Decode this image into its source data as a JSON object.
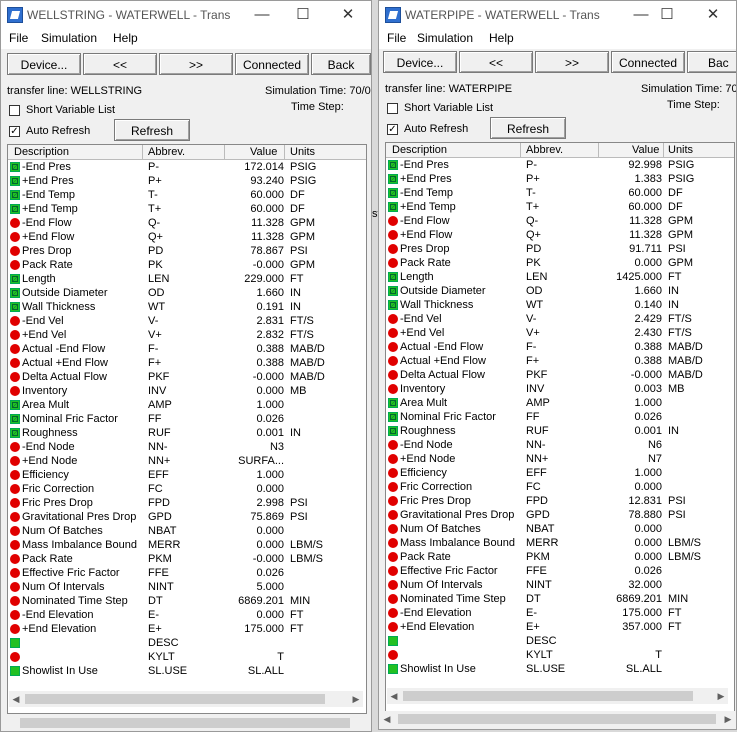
{
  "windows": [
    {
      "title": "WELLSTRING - WATERWELL - Trans",
      "menu": [
        "File",
        "Simulation",
        "Help"
      ],
      "toolbar": {
        "device": "Device...",
        "prev": "<<",
        "next": ">>",
        "connected": "Connected",
        "back": "Back"
      },
      "transfer_line": "transfer line: WELLSTRING",
      "sim_time": "Simulation Time: 70/0",
      "time_step": "Time Step:",
      "short_var": "Short Variable List",
      "auto_refresh": "Auto Refresh",
      "refresh": "Refresh",
      "columns": [
        "Description",
        "Abbrev.",
        "Value",
        "Units"
      ],
      "rows": [
        {
          "i": "g",
          "d": "-End Pres",
          "a": "P-",
          "v": "172.014",
          "u": "PSIG"
        },
        {
          "i": "g",
          "d": "+End Pres",
          "a": "P+",
          "v": "93.240",
          "u": "PSIG"
        },
        {
          "i": "g",
          "d": "-End Temp",
          "a": "T-",
          "v": "60.000",
          "u": "DF"
        },
        {
          "i": "g",
          "d": "+End Temp",
          "a": "T+",
          "v": "60.000",
          "u": "DF"
        },
        {
          "i": "r",
          "d": "-End Flow",
          "a": "Q-",
          "v": "11.328",
          "u": "GPM"
        },
        {
          "i": "r",
          "d": "+End Flow",
          "a": "Q+",
          "v": "11.328",
          "u": "GPM"
        },
        {
          "i": "r",
          "d": "Pres Drop",
          "a": "PD",
          "v": "78.867",
          "u": "PSI"
        },
        {
          "i": "r",
          "d": "Pack Rate",
          "a": "PK",
          "v": "-0.000",
          "u": "GPM"
        },
        {
          "i": "g",
          "d": "Length",
          "a": "LEN",
          "v": "229.000",
          "u": "FT"
        },
        {
          "i": "g",
          "d": "Outside Diameter",
          "a": "OD",
          "v": "1.660",
          "u": "IN"
        },
        {
          "i": "g",
          "d": "Wall Thickness",
          "a": "WT",
          "v": "0.191",
          "u": "IN"
        },
        {
          "i": "r",
          "d": "-End Vel",
          "a": "V-",
          "v": "2.831",
          "u": "FT/S"
        },
        {
          "i": "r",
          "d": "+End Vel",
          "a": "V+",
          "v": "2.832",
          "u": "FT/S"
        },
        {
          "i": "r",
          "d": "Actual -End Flow",
          "a": "F-",
          "v": "0.388",
          "u": "MAB/D"
        },
        {
          "i": "r",
          "d": "Actual +End Flow",
          "a": "F+",
          "v": "0.388",
          "u": "MAB/D"
        },
        {
          "i": "r",
          "d": "Delta Actual Flow",
          "a": "PKF",
          "v": "-0.000",
          "u": "MAB/D"
        },
        {
          "i": "r",
          "d": "Inventory",
          "a": "INV",
          "v": "0.000",
          "u": "MB"
        },
        {
          "i": "g",
          "d": "Area Mult",
          "a": "AMP",
          "v": "1.000",
          "u": ""
        },
        {
          "i": "g",
          "d": "Nominal Fric Factor",
          "a": "FF",
          "v": "0.026",
          "u": ""
        },
        {
          "i": "g",
          "d": "Roughness",
          "a": "RUF",
          "v": "0.001",
          "u": "IN"
        },
        {
          "i": "r",
          "d": "-End Node",
          "a": "NN-",
          "v": "N3",
          "u": ""
        },
        {
          "i": "r",
          "d": "+End Node",
          "a": "NN+",
          "v": "SURFA...",
          "u": ""
        },
        {
          "i": "r",
          "d": "Efficiency",
          "a": "EFF",
          "v": "1.000",
          "u": ""
        },
        {
          "i": "r",
          "d": "Fric Correction",
          "a": "FC",
          "v": "0.000",
          "u": ""
        },
        {
          "i": "r",
          "d": "Fric Pres Drop",
          "a": "FPD",
          "v": "2.998",
          "u": "PSI"
        },
        {
          "i": "r",
          "d": "Gravitational Pres Drop",
          "a": "GPD",
          "v": "75.869",
          "u": "PSI"
        },
        {
          "i": "r",
          "d": "Num Of Batches",
          "a": "NBAT",
          "v": "0.000",
          "u": ""
        },
        {
          "i": "r",
          "d": "Mass Imbalance Bound",
          "a": "MERR",
          "v": "0.000",
          "u": "LBM/S"
        },
        {
          "i": "r",
          "d": "Pack Rate",
          "a": "PKM",
          "v": "-0.000",
          "u": "LBM/S"
        },
        {
          "i": "r",
          "d": "Effective Fric Factor",
          "a": "FFE",
          "v": "0.026",
          "u": ""
        },
        {
          "i": "r",
          "d": "Num Of Intervals",
          "a": "NINT",
          "v": "5.000",
          "u": ""
        },
        {
          "i": "r",
          "d": "Nominated Time Step",
          "a": "DT",
          "v": "6869.201",
          "u": "MIN"
        },
        {
          "i": "r",
          "d": "-End Elevation",
          "a": "E-",
          "v": "0.000",
          "u": "FT"
        },
        {
          "i": "r",
          "d": "+End Elevation",
          "a": "E+",
          "v": "175.000",
          "u": "FT"
        },
        {
          "i": "ng",
          "d": "",
          "a": "DESC",
          "v": "",
          "u": ""
        },
        {
          "i": "r",
          "d": "",
          "a": "KYLT",
          "v": "T",
          "u": ""
        },
        {
          "i": "ng",
          "d": "Showlist In Use",
          "a": "SL.USE",
          "v": "SL.ALL",
          "u": ""
        }
      ]
    },
    {
      "title": "WATERPIPE - WATERWELL - Trans",
      "menu": [
        "File",
        "Simulation",
        "Help"
      ],
      "toolbar": {
        "device": "Device...",
        "prev": "<<",
        "next": ">>",
        "connected": "Connected",
        "back": "Bac"
      },
      "transfer_line": "transfer line: WATERPIPE",
      "sim_time": "Simulation Time: 70",
      "time_step": "Time Step:",
      "short_var": "Short Variable List",
      "auto_refresh": "Auto Refresh",
      "refresh": "Refresh",
      "columns": [
        "Description",
        "Abbrev.",
        "Value",
        "Units"
      ],
      "rows": [
        {
          "i": "g",
          "d": "-End Pres",
          "a": "P-",
          "v": "92.998",
          "u": "PSIG"
        },
        {
          "i": "g",
          "d": "+End Pres",
          "a": "P+",
          "v": "1.383",
          "u": "PSIG"
        },
        {
          "i": "g",
          "d": "-End Temp",
          "a": "T-",
          "v": "60.000",
          "u": "DF"
        },
        {
          "i": "g",
          "d": "+End Temp",
          "a": "T+",
          "v": "60.000",
          "u": "DF"
        },
        {
          "i": "r",
          "d": "-End Flow",
          "a": "Q-",
          "v": "11.328",
          "u": "GPM"
        },
        {
          "i": "r",
          "d": "+End Flow",
          "a": "Q+",
          "v": "11.328",
          "u": "GPM"
        },
        {
          "i": "r",
          "d": "Pres Drop",
          "a": "PD",
          "v": "91.711",
          "u": "PSI"
        },
        {
          "i": "r",
          "d": "Pack Rate",
          "a": "PK",
          "v": "0.000",
          "u": "GPM"
        },
        {
          "i": "g",
          "d": "Length",
          "a": "LEN",
          "v": "1425.000",
          "u": "FT"
        },
        {
          "i": "g",
          "d": "Outside Diameter",
          "a": "OD",
          "v": "1.660",
          "u": "IN"
        },
        {
          "i": "g",
          "d": "Wall Thickness",
          "a": "WT",
          "v": "0.140",
          "u": "IN"
        },
        {
          "i": "r",
          "d": "-End Vel",
          "a": "V-",
          "v": "2.429",
          "u": "FT/S"
        },
        {
          "i": "r",
          "d": "+End Vel",
          "a": "V+",
          "v": "2.430",
          "u": "FT/S"
        },
        {
          "i": "r",
          "d": "Actual -End Flow",
          "a": "F-",
          "v": "0.388",
          "u": "MAB/D"
        },
        {
          "i": "r",
          "d": "Actual +End Flow",
          "a": "F+",
          "v": "0.388",
          "u": "MAB/D"
        },
        {
          "i": "r",
          "d": "Delta Actual Flow",
          "a": "PKF",
          "v": "-0.000",
          "u": "MAB/D"
        },
        {
          "i": "r",
          "d": "Inventory",
          "a": "INV",
          "v": "0.003",
          "u": "MB"
        },
        {
          "i": "g",
          "d": "Area Mult",
          "a": "AMP",
          "v": "1.000",
          "u": ""
        },
        {
          "i": "g",
          "d": "Nominal Fric Factor",
          "a": "FF",
          "v": "0.026",
          "u": ""
        },
        {
          "i": "g",
          "d": "Roughness",
          "a": "RUF",
          "v": "0.001",
          "u": "IN"
        },
        {
          "i": "r",
          "d": "-End Node",
          "a": "NN-",
          "v": "N6",
          "u": ""
        },
        {
          "i": "r",
          "d": "+End Node",
          "a": "NN+",
          "v": "N7",
          "u": ""
        },
        {
          "i": "r",
          "d": "Efficiency",
          "a": "EFF",
          "v": "1.000",
          "u": ""
        },
        {
          "i": "r",
          "d": "Fric Correction",
          "a": "FC",
          "v": "0.000",
          "u": ""
        },
        {
          "i": "r",
          "d": "Fric Pres Drop",
          "a": "FPD",
          "v": "12.831",
          "u": "PSI"
        },
        {
          "i": "r",
          "d": "Gravitational Pres Drop",
          "a": "GPD",
          "v": "78.880",
          "u": "PSI"
        },
        {
          "i": "r",
          "d": "Num Of Batches",
          "a": "NBAT",
          "v": "0.000",
          "u": ""
        },
        {
          "i": "r",
          "d": "Mass Imbalance Bound",
          "a": "MERR",
          "v": "0.000",
          "u": "LBM/S"
        },
        {
          "i": "r",
          "d": "Pack Rate",
          "a": "PKM",
          "v": "0.000",
          "u": "LBM/S"
        },
        {
          "i": "r",
          "d": "Effective Fric Factor",
          "a": "FFE",
          "v": "0.026",
          "u": ""
        },
        {
          "i": "r",
          "d": "Num Of Intervals",
          "a": "NINT",
          "v": "32.000",
          "u": ""
        },
        {
          "i": "r",
          "d": "Nominated Time Step",
          "a": "DT",
          "v": "6869.201",
          "u": "MIN"
        },
        {
          "i": "r",
          "d": "-End Elevation",
          "a": "E-",
          "v": "175.000",
          "u": "FT"
        },
        {
          "i": "r",
          "d": "+End Elevation",
          "a": "E+",
          "v": "357.000",
          "u": "FT"
        },
        {
          "i": "ng",
          "d": "",
          "a": "DESC",
          "v": "",
          "u": ""
        },
        {
          "i": "r",
          "d": "",
          "a": "KYLT",
          "v": "T",
          "u": ""
        },
        {
          "i": "ng",
          "d": "Showlist In Use",
          "a": "SL.USE",
          "v": "SL.ALL",
          "u": ""
        }
      ]
    }
  ],
  "behind_window_fragment": "st"
}
